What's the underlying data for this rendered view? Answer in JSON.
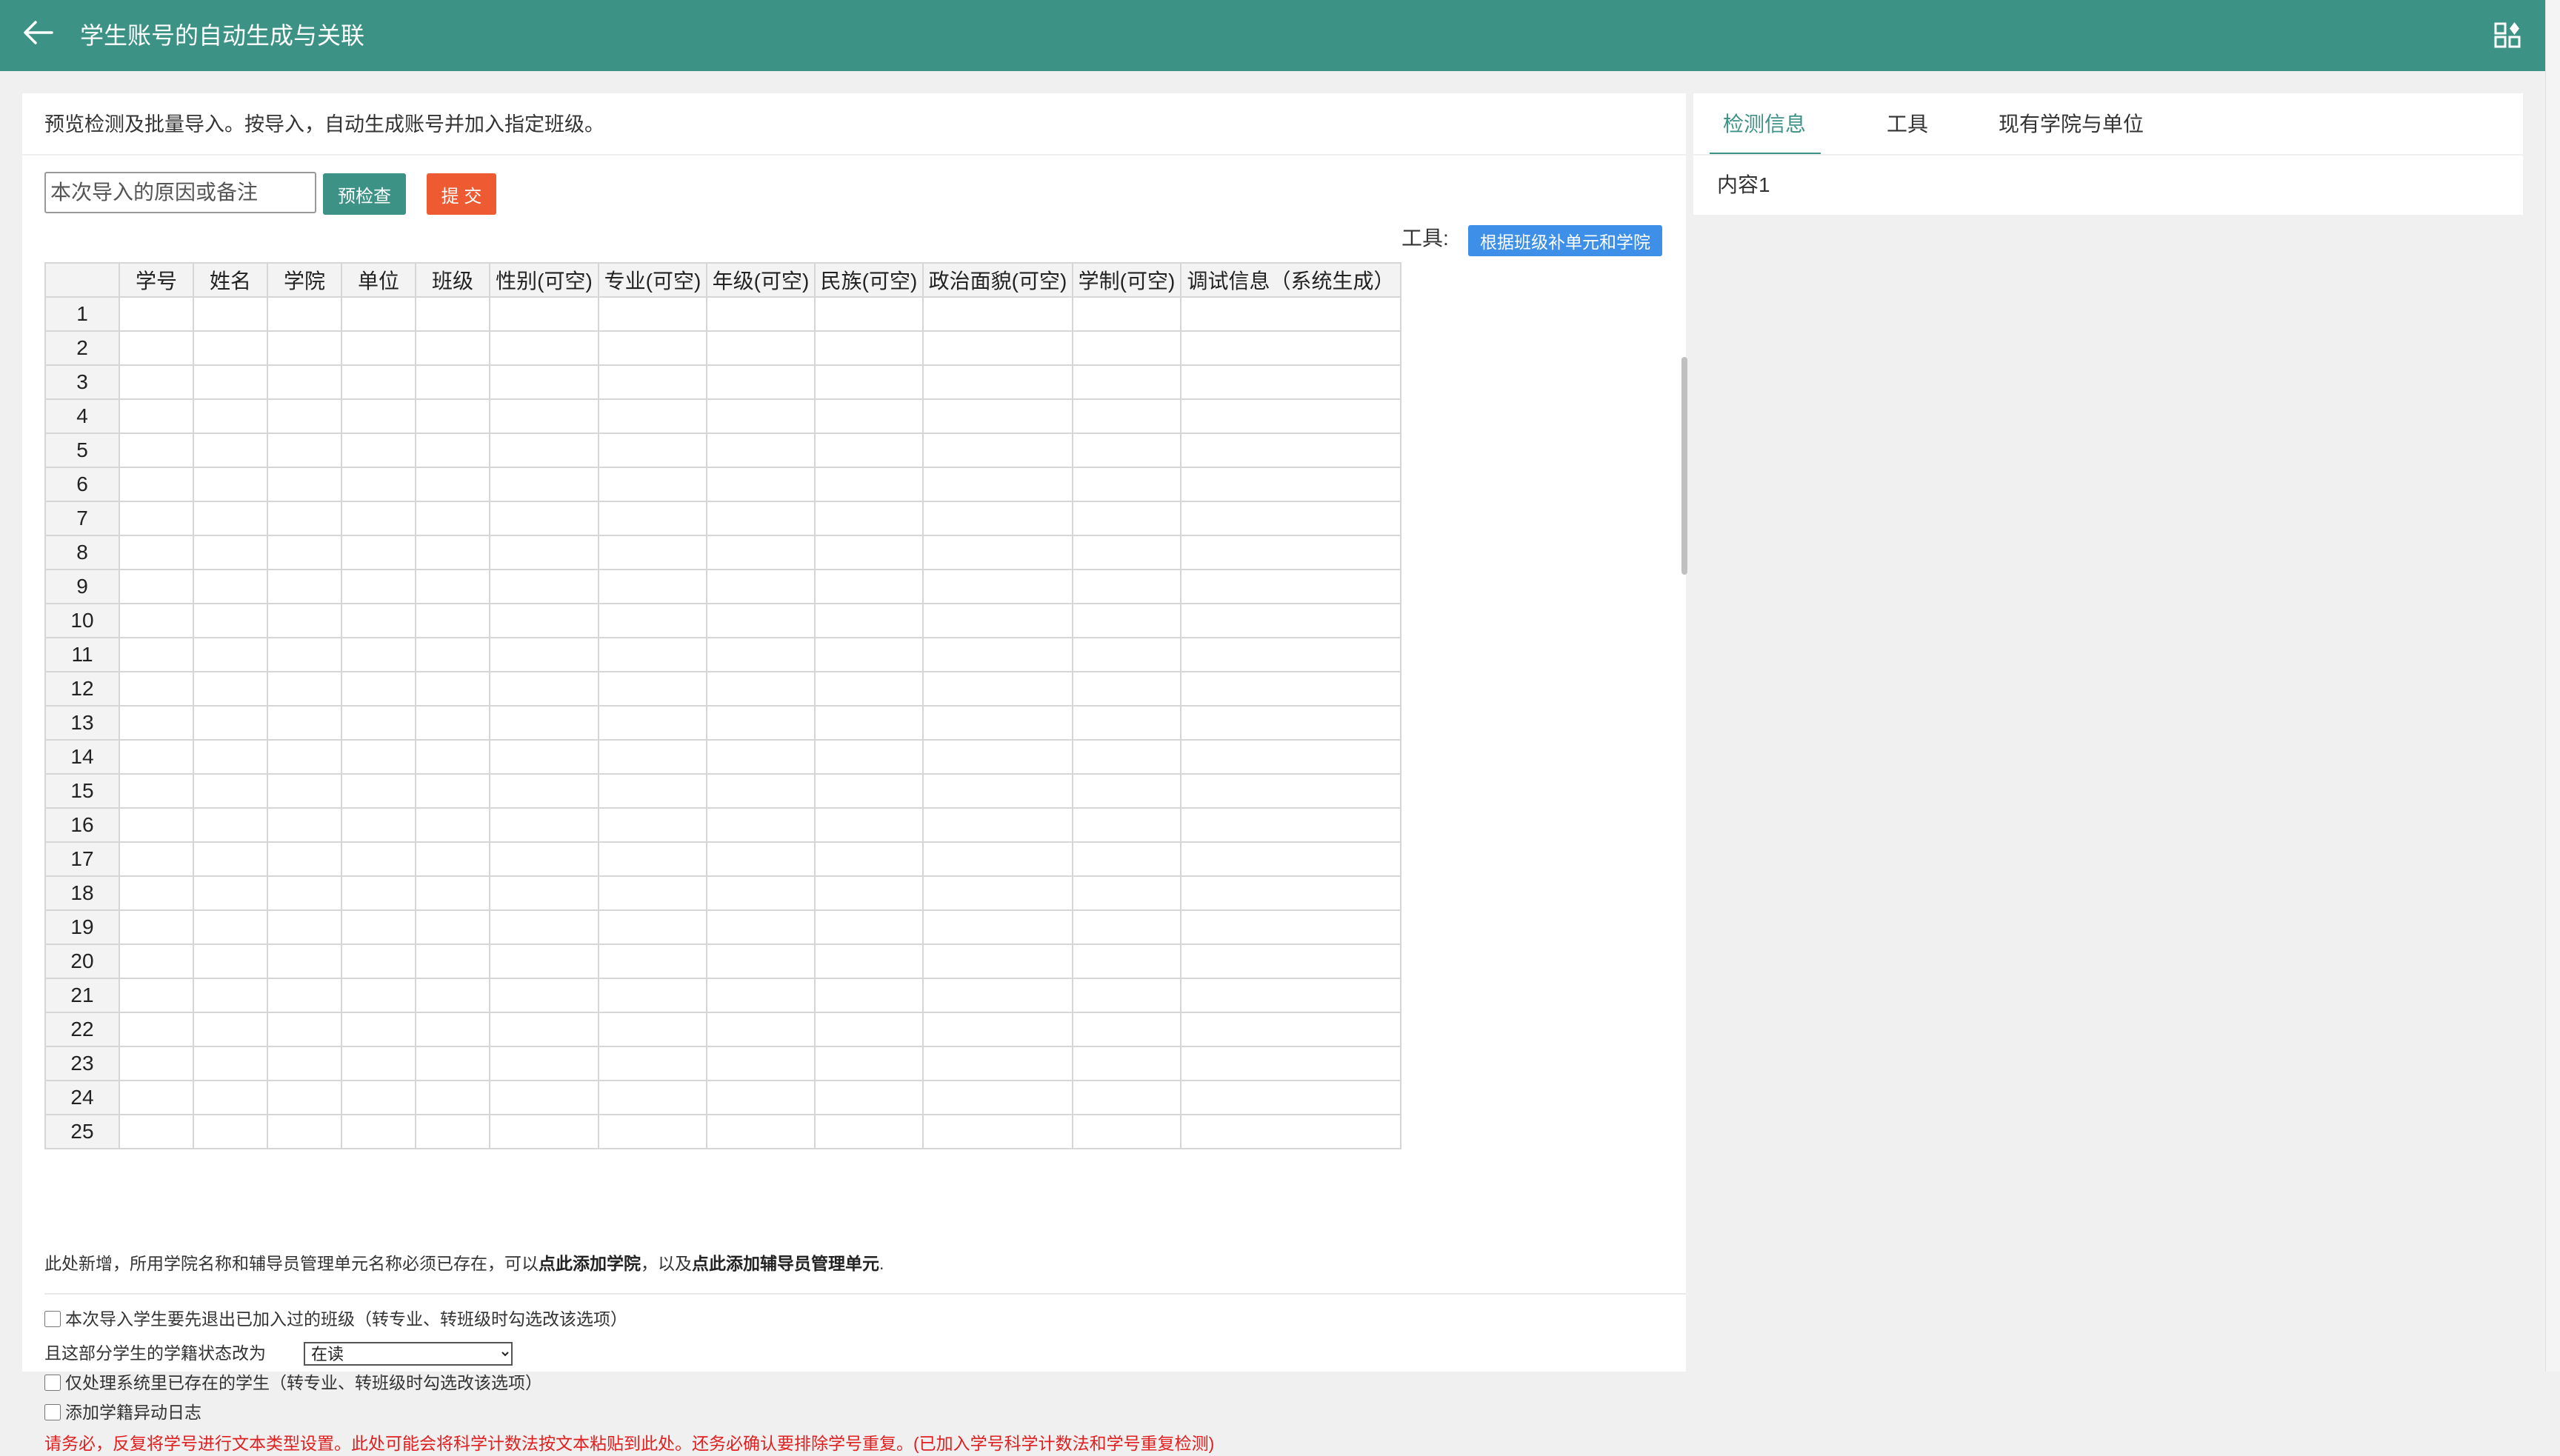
{
  "topbar": {
    "title": "学生账号的自动生成与关联",
    "back_icon": "arrow-left-icon",
    "apps_icon": "apps-grid-icon",
    "bg": "#3c9285"
  },
  "main": {
    "description": "预览检测及批量导入。按导入，自动生成账号并加入指定班级。",
    "remark_placeholder": "本次导入的原因或备注",
    "precheck_label": "预检查",
    "submit_label": "提 交",
    "tools_label": "工具:",
    "fill_unit_label": "根据班级补单元和学院",
    "grid": {
      "columns": [
        "学号",
        "姓名",
        "学院",
        "单位",
        "班级",
        "性别(可空)",
        "专业(可空)",
        "年级(可空)",
        "民族(可空)",
        "政治面貌(可空)",
        "学制(可空)",
        "调试信息（系统生成）"
      ],
      "row_numbers": [
        "1",
        "2",
        "3",
        "4",
        "5",
        "6",
        "7",
        "8",
        "9",
        "10",
        "11",
        "12",
        "13",
        "14",
        "15",
        "16",
        "17",
        "18",
        "19",
        "20",
        "21",
        "22",
        "23",
        "24",
        "25"
      ]
    },
    "note": {
      "prefix": "此处新增，所用学院名称和辅导员管理单元名称必须已存在，可以",
      "link1": "点此添加学院",
      "middle": "，以及",
      "link2": "点此添加辅导员管理单元",
      "suffix": "."
    },
    "options": {
      "exit_class_label": "本次导入学生要先退出已加入过的班级（转专业、转班级时勾选改该选项）",
      "status_label": "且这部分学生的学籍状态改为",
      "status_value": "在读",
      "only_existing_label": "仅处理系统里已存在的学生（转专业、转班级时勾选改该选项）",
      "add_log_label": "添加学籍异动日志"
    },
    "warning": "请务必，反复将学号进行文本类型设置。此处可能会将科学计数法按文本粘贴到此处。还务必确认要排除学号重复。(已加入学号科学计数法和学号重复检测)"
  },
  "side": {
    "tabs": [
      "检测信息",
      "工具",
      "现有学院与单位"
    ],
    "content": "内容1",
    "accent": "#3c9285"
  }
}
